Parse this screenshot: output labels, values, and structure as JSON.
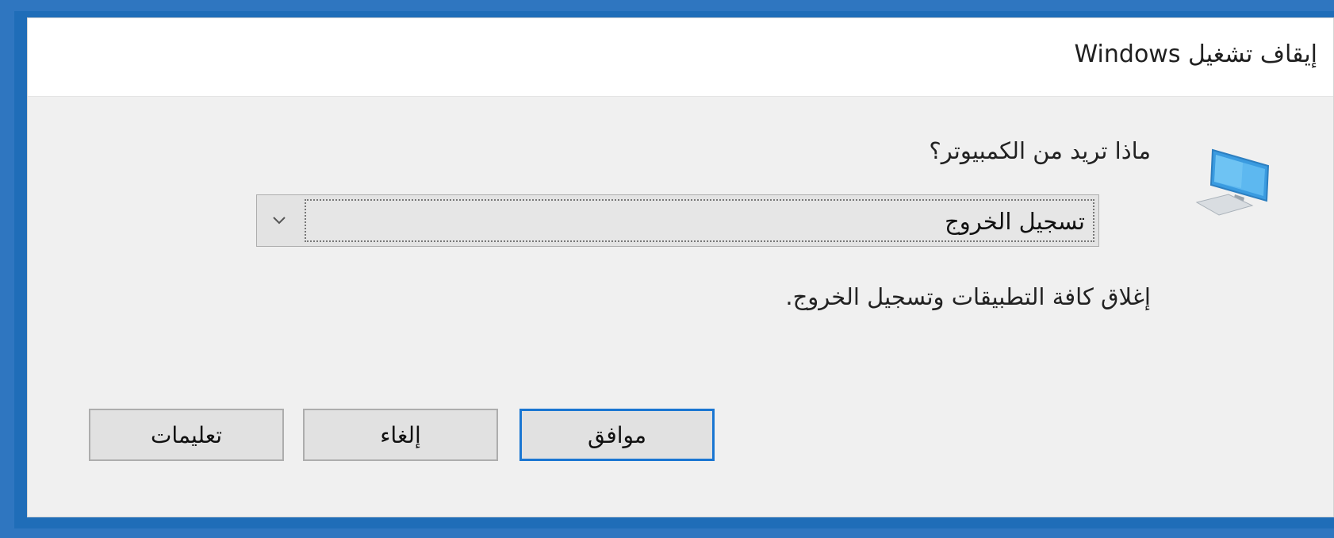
{
  "window": {
    "title": "إيقاف تشغيل Windows"
  },
  "icon": {
    "name": "computer-icon"
  },
  "prompt": {
    "question": "ماذا تريد من الكمبيوتر؟"
  },
  "action_select": {
    "selected": "تسجيل الخروج"
  },
  "description": "إغلاق كافة التطبيقات وتسجيل الخروج.",
  "buttons": {
    "ok": "موافق",
    "cancel": "إلغاء",
    "help": "تعليمات"
  },
  "colors": {
    "accent": "#1a76d2",
    "window_frame": "#1f6db8"
  }
}
